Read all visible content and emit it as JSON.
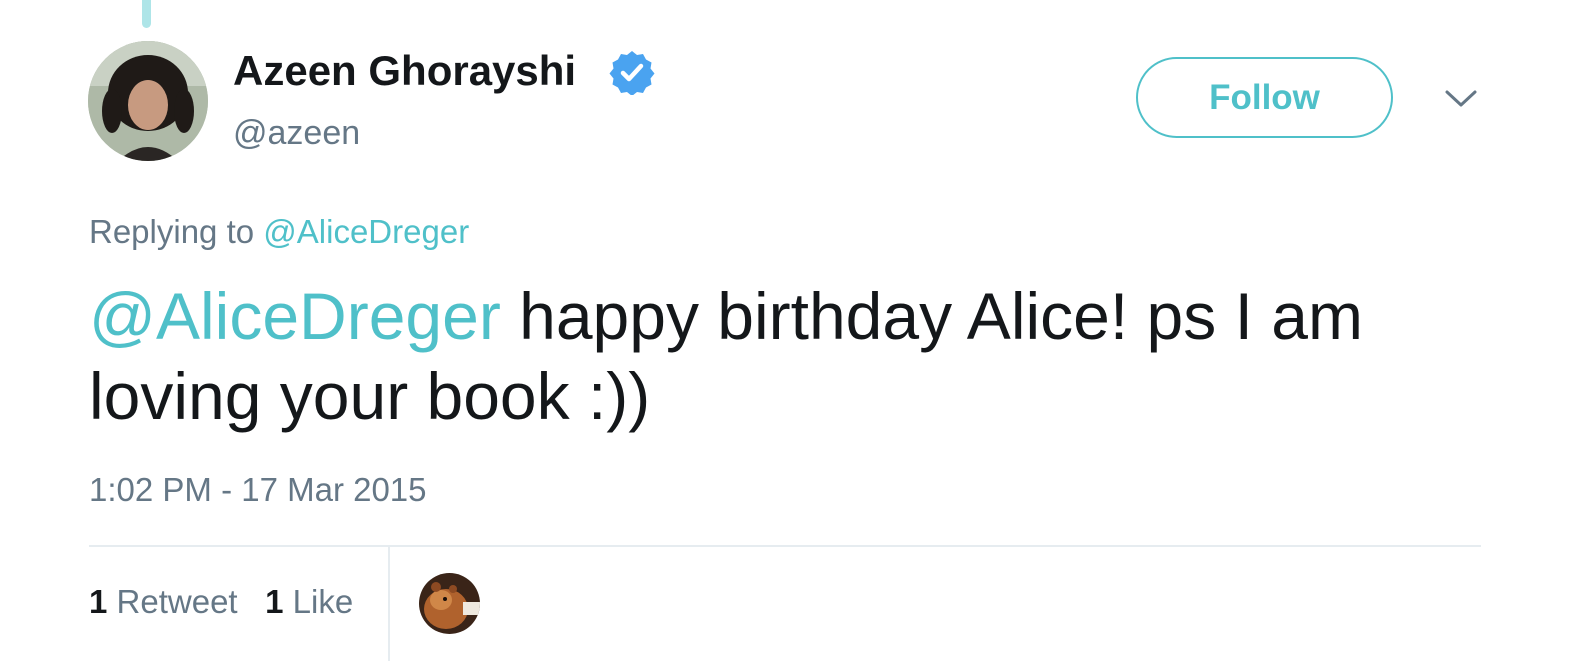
{
  "tweet": {
    "author": {
      "name": "Azeen Ghorayshi",
      "handle": "@azeen",
      "verified": true
    },
    "follow_label": "Follow",
    "replying_prefix": "Replying to",
    "replying_to": "@AliceDreger",
    "text_mention": "@AliceDreger",
    "text_body": " happy birthday Alice! ps I am loving your book :))",
    "timestamp": "1:02 PM - 17 Mar 2015",
    "stats": {
      "retweet_count": "1",
      "retweet_label": "Retweet",
      "like_count": "1",
      "like_label": "Like"
    }
  },
  "colors": {
    "accent": "#4fc0c9",
    "verified_blue": "#4aa3f0",
    "text_primary": "#14171a",
    "text_secondary": "#657786",
    "divider": "#e6ecf0"
  },
  "icons": {
    "verified": "verified-badge-icon",
    "menu": "chevron-down-icon"
  }
}
